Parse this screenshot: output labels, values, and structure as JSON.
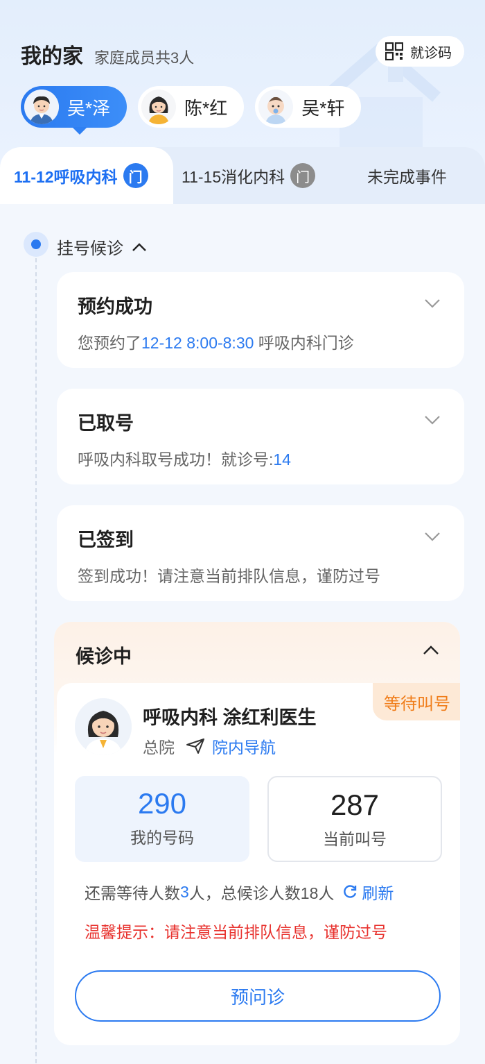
{
  "header": {
    "title": "我的家",
    "subtitle": "家庭成员共3人",
    "qr_label": "就诊码"
  },
  "members": [
    {
      "name": "吴*泽",
      "active": true
    },
    {
      "name": "陈*红",
      "active": false
    },
    {
      "name": "吴*轩",
      "active": false
    }
  ],
  "tabs": [
    {
      "label": "11-12呼吸内科",
      "badge": "门",
      "active": true
    },
    {
      "label": "11-15消化内科",
      "badge": "门",
      "active": false
    },
    {
      "label": "未完成事件",
      "active": false
    }
  ],
  "stage": {
    "label": "挂号候诊"
  },
  "cards": [
    {
      "title": "预约成功",
      "desc_prefix": "您预约了",
      "desc_highlight": "12-12 8:00-8:30",
      "desc_suffix": " 呼吸内科门诊"
    },
    {
      "title": "已取号",
      "desc_prefix": "呼吸内科取号成功！就诊号:",
      "desc_highlight": "14"
    },
    {
      "title": "已签到",
      "desc_prefix": "签到成功！请注意当前排队信息，谨防过号"
    }
  ],
  "waiting": {
    "title": "候诊中",
    "status_tag": "等待叫号",
    "doctor": "呼吸内科 涂红利医生",
    "hospital": "总院",
    "nav_label": "院内导航",
    "my_number": "290",
    "my_number_label": "我的号码",
    "current_number": "287",
    "current_number_label": "当前叫号",
    "wait_prefix": "还需等待人数",
    "wait_count": "3",
    "wait_suffix": "人，总候诊人数18人",
    "refresh_label": "刷新",
    "tip": "温馨提示：请注意当前排队信息，谨防过号",
    "pre_consult_label": "预问诊"
  },
  "colors": {
    "accent": "#2b7af0",
    "warning": "#f07d1a",
    "danger": "#e8332f"
  }
}
